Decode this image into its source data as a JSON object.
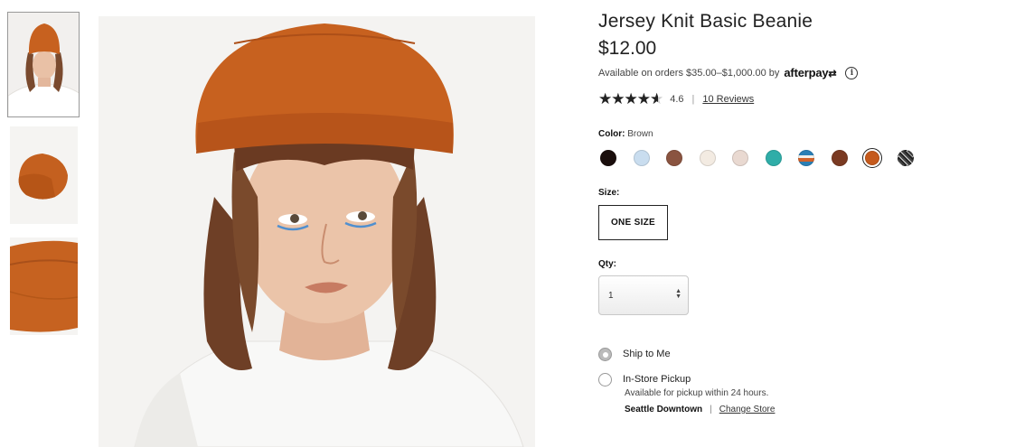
{
  "product": {
    "title": "Jersey Knit Basic Beanie",
    "price": "$12.00"
  },
  "afterpay": {
    "text": "Available on orders $35.00–$1,000.00 by",
    "logo_text": "afterpay",
    "info_glyph": "i"
  },
  "rating": {
    "value": 4.6,
    "value_text": "4.6",
    "max": 5,
    "separator": "|",
    "reviews_label": "10 Reviews"
  },
  "color": {
    "label": "Color:",
    "selected_name": "Brown",
    "swatches": [
      {
        "name": "black",
        "hex": "#1a0e0c"
      },
      {
        "name": "light-blue",
        "hex": "#c9ddef"
      },
      {
        "name": "brown-heather",
        "hex": "#8a5440"
      },
      {
        "name": "cream",
        "hex": "#f3ebe2"
      },
      {
        "name": "blush",
        "hex": "#e9d9d1"
      },
      {
        "name": "teal",
        "hex": "#2fada8"
      },
      {
        "name": "multi-stripe",
        "hex": "#d27b3b"
      },
      {
        "name": "rust-brown",
        "hex": "#7a3a22"
      },
      {
        "name": "brown",
        "hex": "#c55a1c",
        "selected": true
      },
      {
        "name": "black-white-marled",
        "hex": "#3d3d3d"
      }
    ]
  },
  "size": {
    "label": "Size:",
    "selected": "ONE SIZE"
  },
  "qty": {
    "label": "Qty:",
    "value": "1"
  },
  "fulfillment": {
    "ship_label": "Ship to Me",
    "pickup_label": "In-Store Pickup",
    "pickup_note": "Available for pickup within 24 hours.",
    "store_name": "Seattle Downtown",
    "separator": "|",
    "change_store_label": "Change Store",
    "selected": "ship"
  },
  "colors": {
    "beanie": "#c7611f",
    "text": "#222222"
  }
}
